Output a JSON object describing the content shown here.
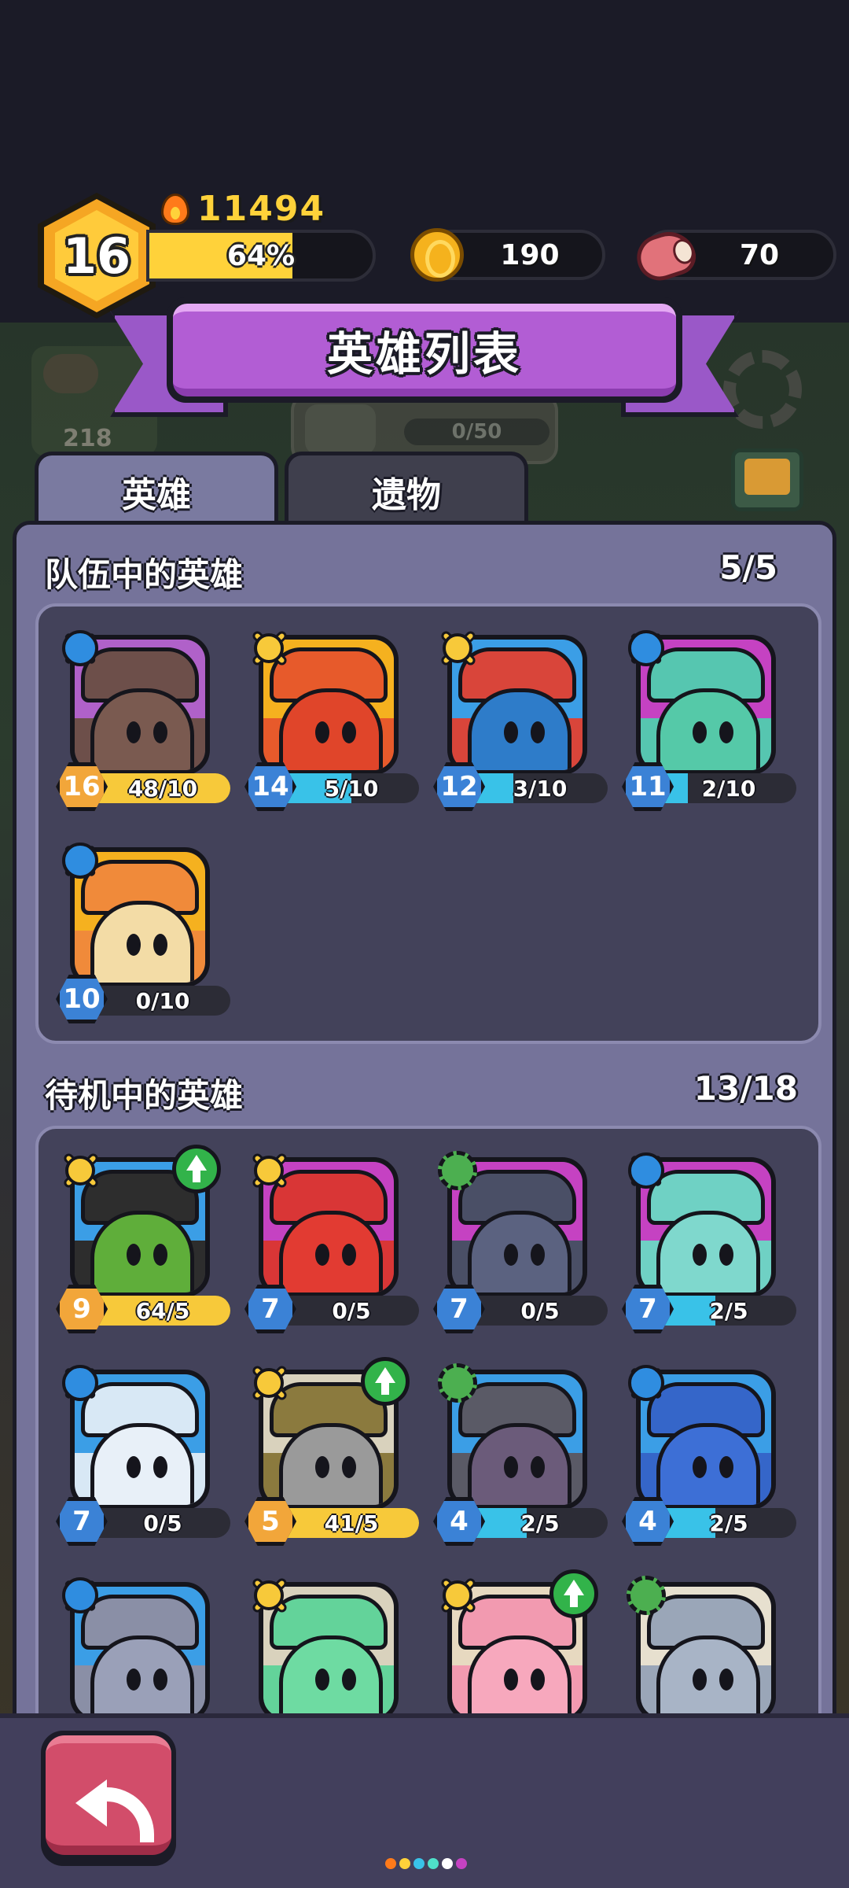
{
  "hud": {
    "player_level": "16",
    "power": "11494",
    "xp_percent_text": "64%",
    "xp_fraction": 0.64,
    "coins": "190",
    "meat": "70"
  },
  "background": {
    "meat_count": "218",
    "skull_progress": "0/50"
  },
  "title": "英雄列表",
  "tabs": [
    {
      "label": "英雄",
      "active": true
    },
    {
      "label": "遗物",
      "active": false
    }
  ],
  "team": {
    "title": "队伍中的英雄",
    "count": "5/5",
    "heroes": [
      {
        "level": "16",
        "progress": "48/10",
        "fill": 1.0,
        "fill_color": "#f7c93a",
        "badge": "blue",
        "level_style": "gold",
        "top": "#b061c9",
        "bottom": "#6d4f4a",
        "body": "#7a5a50"
      },
      {
        "level": "14",
        "progress": "5/10",
        "fill": 0.5,
        "fill_color": "#39c2e8",
        "badge": "yellow",
        "level_style": "blue",
        "top": "#f5b11f",
        "bottom": "#e75a2b",
        "body": "#e0452a"
      },
      {
        "level": "12",
        "progress": "3/10",
        "fill": 0.3,
        "fill_color": "#39c2e8",
        "badge": "yellow",
        "level_style": "blue",
        "top": "#3b9ee6",
        "bottom": "#d9453a",
        "body": "#2e7cc9"
      },
      {
        "level": "11",
        "progress": "2/10",
        "fill": 0.2,
        "fill_color": "#39c2e8",
        "badge": "blue",
        "level_style": "blue",
        "top": "#c542c2",
        "bottom": "#56c6b0",
        "body": "#55c9a8"
      },
      {
        "level": "10",
        "progress": "0/10",
        "fill": 0.0,
        "fill_color": "#39c2e8",
        "badge": "blue",
        "level_style": "blue",
        "top": "#f5b11f",
        "bottom": "#f08a3a",
        "body": "#f3dca6"
      }
    ]
  },
  "standby": {
    "title": "待机中的英雄",
    "count": "13/18",
    "heroes": [
      {
        "level": "9",
        "progress": "64/5",
        "fill": 1.0,
        "fill_color": "#f7c93a",
        "badge": "yellow",
        "level_style": "gold",
        "upgrade": true,
        "top": "#3b9ee6",
        "bottom": "#2d2d2d",
        "body": "#5fae3a"
      },
      {
        "level": "7",
        "progress": "0/5",
        "fill": 0.0,
        "fill_color": "#39c2e8",
        "badge": "yellow",
        "level_style": "blue",
        "upgrade": false,
        "top": "#c542c2",
        "bottom": "#d93636",
        "body": "#e23b32"
      },
      {
        "level": "7",
        "progress": "0/5",
        "fill": 0.0,
        "fill_color": "#39c2e8",
        "badge": "green",
        "level_style": "blue",
        "upgrade": false,
        "top": "#c542c2",
        "bottom": "#4a4f66",
        "body": "#5b6280"
      },
      {
        "level": "7",
        "progress": "2/5",
        "fill": 0.4,
        "fill_color": "#39c2e8",
        "badge": "blue",
        "level_style": "blue",
        "upgrade": false,
        "top": "#c542c2",
        "bottom": "#6fd1c4",
        "body": "#7fd8cd"
      },
      {
        "level": "7",
        "progress": "0/5",
        "fill": 0.0,
        "fill_color": "#39c2e8",
        "badge": "blue",
        "level_style": "blue",
        "upgrade": false,
        "top": "#3b9ee6",
        "bottom": "#d8e8f5",
        "body": "#e8f0f8"
      },
      {
        "level": "5",
        "progress": "41/5",
        "fill": 1.0,
        "fill_color": "#f7c93a",
        "badge": "yellow",
        "level_style": "gold",
        "upgrade": true,
        "top": "#d9d2bd",
        "bottom": "#8b7a3e",
        "body": "#9a9a9a"
      },
      {
        "level": "4",
        "progress": "2/5",
        "fill": 0.4,
        "fill_color": "#39c2e8",
        "badge": "green",
        "level_style": "blue",
        "upgrade": false,
        "top": "#3b9ee6",
        "bottom": "#5a5a66",
        "body": "#6b5b7a"
      },
      {
        "level": "4",
        "progress": "2/5",
        "fill": 0.4,
        "fill_color": "#39c2e8",
        "badge": "blue",
        "level_style": "blue",
        "upgrade": false,
        "top": "#3b9ee6",
        "bottom": "#3566c9",
        "body": "#3d6fd6"
      },
      {
        "badge": "blue",
        "upgrade": false,
        "top": "#3b9ee6",
        "bottom": "#8a8fa6",
        "body": "#9aa0b8"
      },
      {
        "badge": "yellow",
        "upgrade": false,
        "top": "#d9d2bd",
        "bottom": "#63d39a",
        "body": "#6edba2"
      },
      {
        "badge": "yellow",
        "upgrade": true,
        "top": "#e7d9c0",
        "bottom": "#f29ab0",
        "body": "#f7a8bd"
      },
      {
        "badge": "green",
        "upgrade": false,
        "top": "#e7e0cf",
        "bottom": "#9aa6b8",
        "body": "#a8b4c6"
      }
    ]
  },
  "page_dots": [
    "#ff7a1a",
    "#ffd23a",
    "#39c2e8",
    "#4fe0c9",
    "#ffffff",
    "#c542c2"
  ]
}
